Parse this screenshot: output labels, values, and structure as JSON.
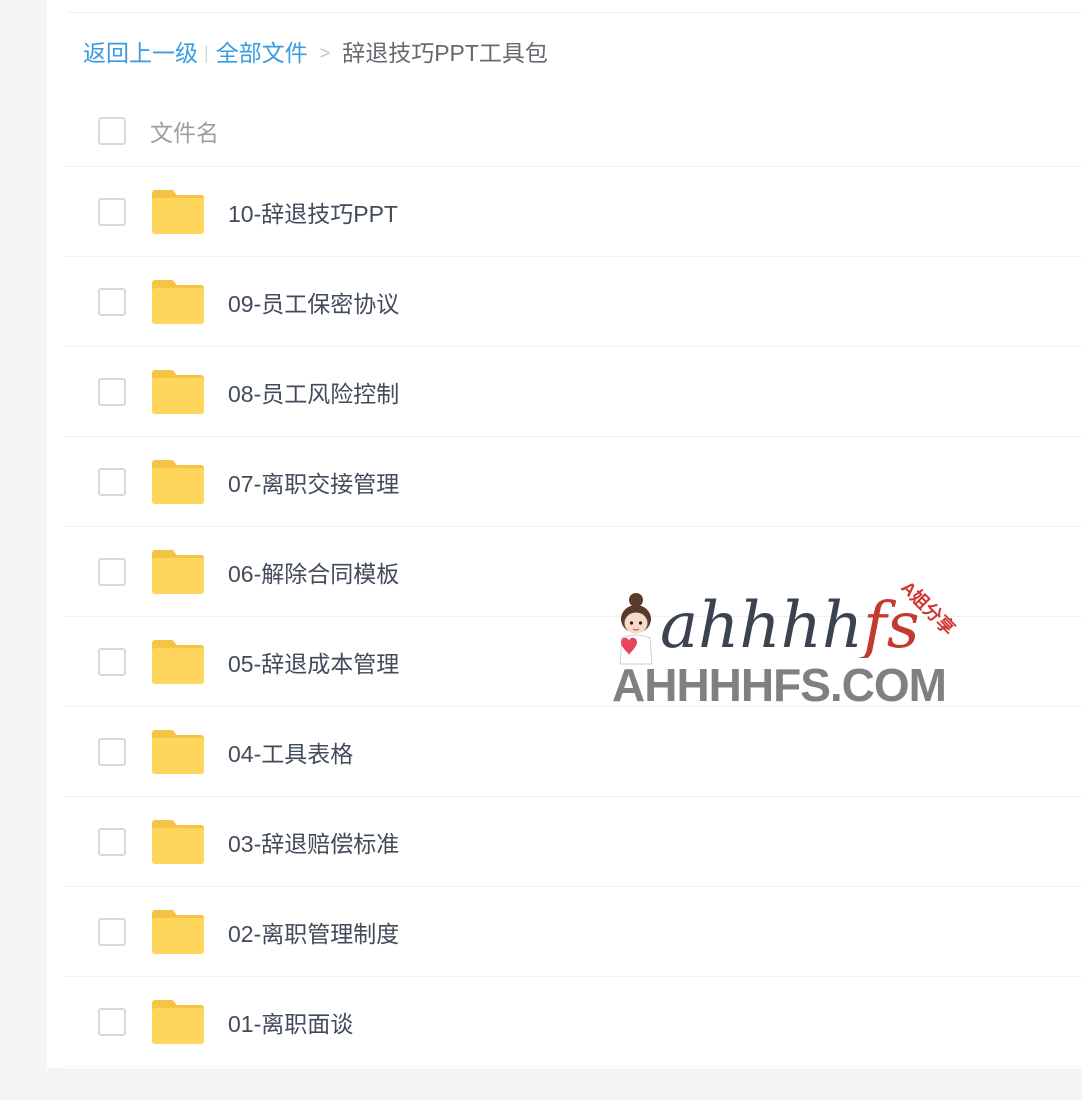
{
  "breadcrumb": {
    "back_label": "返回上一级",
    "separator": "|",
    "root_label": "全部文件",
    "arrow": ">",
    "current_label": "辞退技巧PPT工具包"
  },
  "table": {
    "header_name": "文件名",
    "rows": [
      {
        "name": "10-辞退技巧PPT",
        "icon": "folder-icon"
      },
      {
        "name": "09-员工保密协议",
        "icon": "folder-icon"
      },
      {
        "name": "08-员工风险控制",
        "icon": "folder-icon"
      },
      {
        "name": "07-离职交接管理",
        "icon": "folder-icon"
      },
      {
        "name": "06-解除合同模板",
        "icon": "folder-icon"
      },
      {
        "name": "05-辞退成本管理",
        "icon": "folder-icon"
      },
      {
        "name": "04-工具表格",
        "icon": "folder-icon"
      },
      {
        "name": "03-辞退赔偿标准",
        "icon": "folder-icon"
      },
      {
        "name": "02-离职管理制度",
        "icon": "folder-icon"
      },
      {
        "name": "01-离职面谈",
        "icon": "folder-icon"
      }
    ]
  },
  "watermark": {
    "brand_script": "ahhhhfs",
    "badge": "A姐分享",
    "domain": "AHHHHFS.COM",
    "mascot_icon": "girl-mascot-icon"
  },
  "colors": {
    "link_blue": "#3b9be0",
    "folder_body": "#ffd65c",
    "folder_tab": "#f6c445",
    "watermark_red": "#d0342c"
  }
}
